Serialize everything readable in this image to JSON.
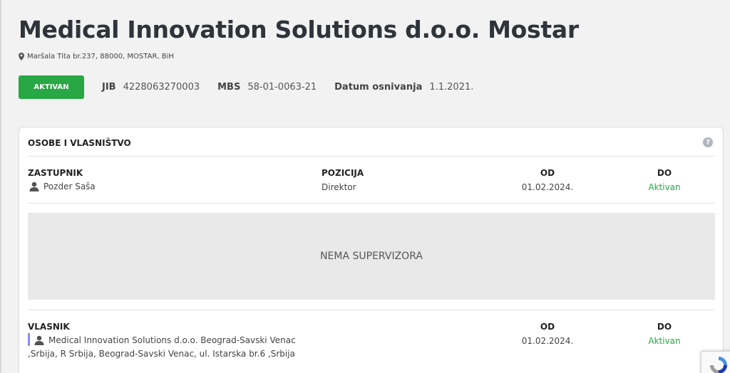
{
  "company": {
    "name": "Medical Innovation Solutions d.o.o. Mostar",
    "address": "Maršala Tita br.237, 88000, MOSTAR, BiH",
    "status_label": "AKTIVAN",
    "status_color": "#28a745",
    "meta": [
      {
        "key": "JIB",
        "value": "4228063270003"
      },
      {
        "key": "MBS",
        "value": "58-01-0063-21"
      },
      {
        "key": "Datum osnivanja",
        "value": "1.1.2021."
      }
    ]
  },
  "section": {
    "title": "OSOBE I VLASNIŠTVO",
    "help_icon": "question-circle-icon",
    "representative": {
      "headers": {
        "name": "ZASTUPNIK",
        "position": "POZICIJA",
        "from": "OD",
        "to": "DO"
      },
      "name": "Pozder Saša",
      "position": "Direktor",
      "from": "01.02.2024.",
      "to": "Aktivan"
    },
    "supervisors_empty": "NEMA SUPERVIZORA",
    "owner": {
      "headers": {
        "name": "VLASNIK",
        "from": "OD",
        "to": "DO"
      },
      "name_line1": "Medical Innovation Solutions d.o.o. Beograd-Savski Venac",
      "name_line2": ",Srbija, R Srbija, Beograd-Savski Venac, ul. Istarska br.6 ,Srbija",
      "from": "01.02.2024.",
      "to": "Aktivan"
    }
  }
}
